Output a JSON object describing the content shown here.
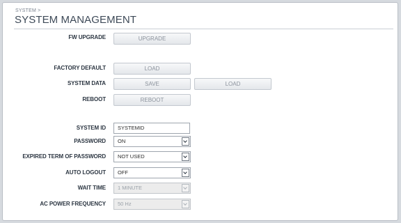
{
  "header": {
    "breadcrumb": "SYSTEM >",
    "title": "SYSTEM MANAGEMENT"
  },
  "fw_upgrade": {
    "label": "FW UPGRADE",
    "button": "UPGRADE"
  },
  "factory_default": {
    "label": "FACTORY DEFAULT",
    "button": "LOAD"
  },
  "system_data": {
    "label": "SYSTEM DATA",
    "save_button": "SAVE",
    "load_button": "LOAD"
  },
  "reboot": {
    "label": "REBOOT",
    "button": "REBOOT"
  },
  "system_id": {
    "label": "SYSTEM ID",
    "value": "SYSTEMID"
  },
  "password": {
    "label": "PASSWORD",
    "value": "ON"
  },
  "expired_term": {
    "label": "EXPIRED TERM OF PASSWORD",
    "value": "NOT USED"
  },
  "auto_logout": {
    "label": "AUTO LOGOUT",
    "value": "OFF"
  },
  "wait_time": {
    "label": "WAIT TIME",
    "value": "1 MINUTE"
  },
  "ac_power": {
    "label": "AC POWER FREQUENCY",
    "value": "50 Hz"
  },
  "colors": {
    "background": "#d6dadf",
    "panel": "#ffffff",
    "label_text": "#2c3642",
    "title_text": "#3e4a58",
    "button_text": "#8b929c"
  }
}
